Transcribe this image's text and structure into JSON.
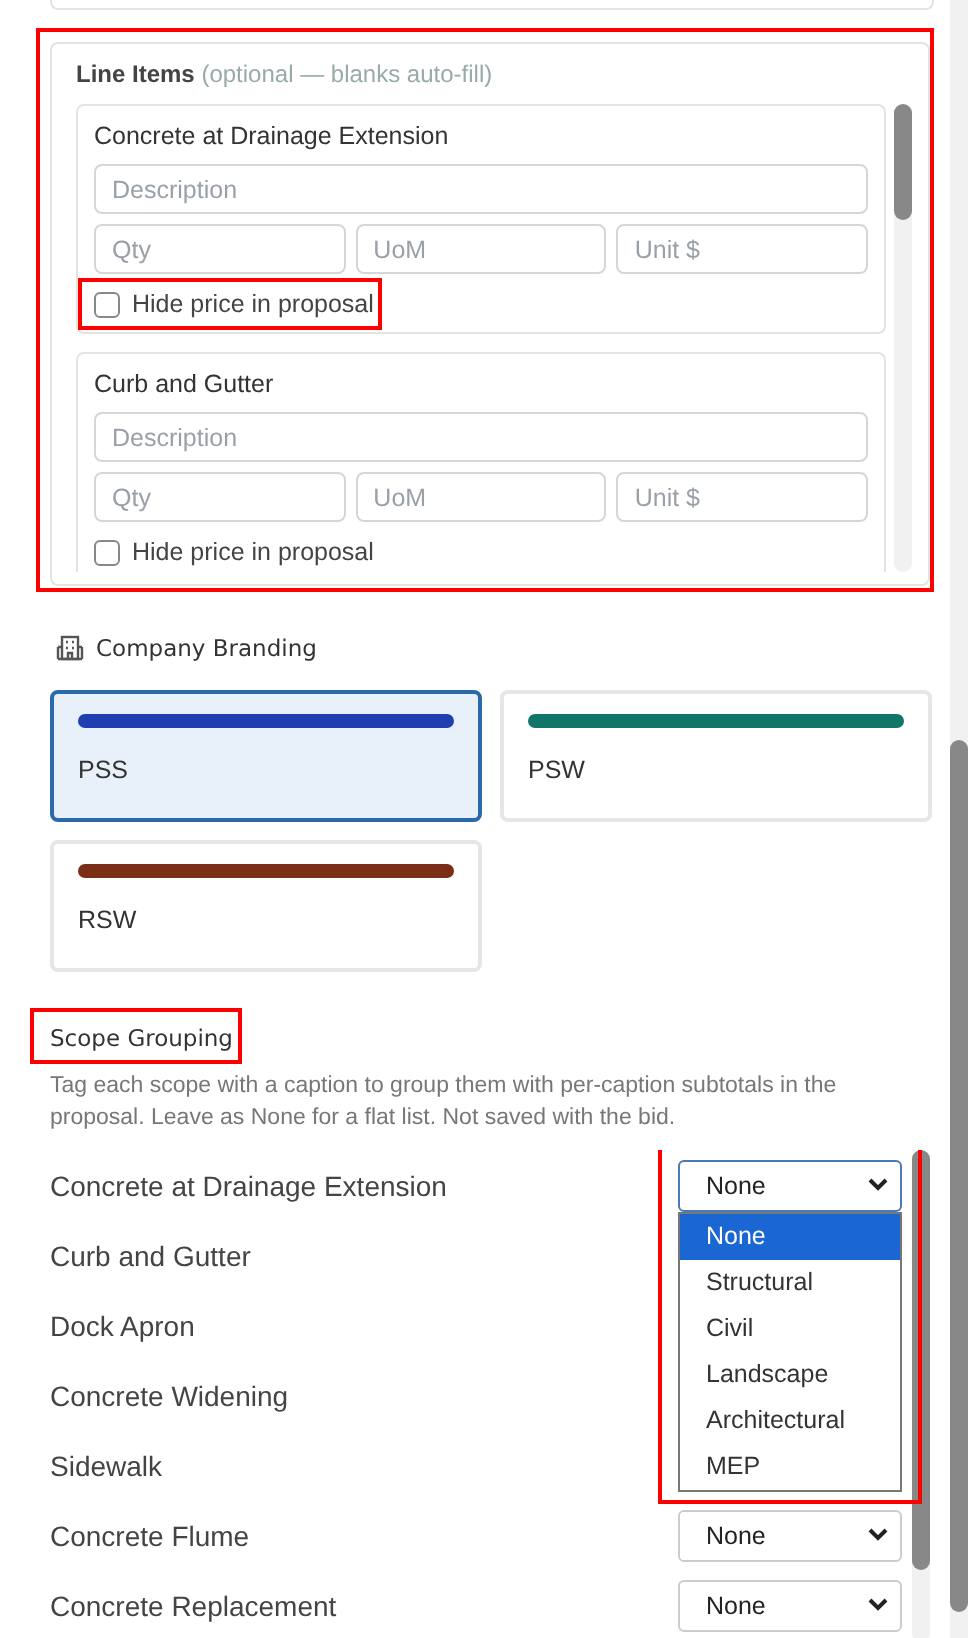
{
  "line_items": {
    "title": "Line Items",
    "hint": "(optional — blanks auto-fill)",
    "highlighted": true,
    "items": [
      {
        "name": "Concrete at Drainage Extension",
        "description_placeholder": "Description",
        "qty_placeholder": "Qty",
        "uom_placeholder": "UoM",
        "unit_price_placeholder": "Unit $",
        "hide_price": {
          "label": "Hide price in proposal",
          "checked": false,
          "highlighted": true
        }
      },
      {
        "name": "Curb and Gutter",
        "description_placeholder": "Description",
        "qty_placeholder": "Qty",
        "uom_placeholder": "UoM",
        "unit_price_placeholder": "Unit $",
        "hide_price": {
          "label": "Hide price in proposal",
          "checked": false
        }
      }
    ]
  },
  "company_branding": {
    "title": "Company Branding",
    "options": [
      {
        "label": "PSS",
        "color": "#1f3fb0",
        "selected": true
      },
      {
        "label": "PSW",
        "color": "#10766a",
        "selected": false
      },
      {
        "label": "RSW",
        "color": "#7b2e16",
        "selected": false
      }
    ]
  },
  "scope_grouping": {
    "title": "Scope Grouping",
    "highlighted": true,
    "description": "Tag each scope with a caption to group them with per-caption subtotals in the proposal. Leave as None for a flat list. Not saved with the bid.",
    "rows": [
      {
        "name": "Concrete at Drainage Extension",
        "value": "None",
        "expanded": true,
        "highlighted": true,
        "options": [
          {
            "label": "None",
            "selected": true
          },
          {
            "label": "Structural",
            "selected": false
          },
          {
            "label": "Civil",
            "selected": false
          },
          {
            "label": "Landscape",
            "selected": false
          },
          {
            "label": "Architectural",
            "selected": false
          },
          {
            "label": "MEP",
            "selected": false
          }
        ]
      },
      {
        "name": "Curb and Gutter"
      },
      {
        "name": "Dock Apron"
      },
      {
        "name": "Concrete Widening"
      },
      {
        "name": "Sidewalk"
      },
      {
        "name": "Concrete Flume",
        "value": "None",
        "expanded": false
      },
      {
        "name": "Concrete Replacement",
        "value": "None",
        "expanded": false
      }
    ]
  }
}
